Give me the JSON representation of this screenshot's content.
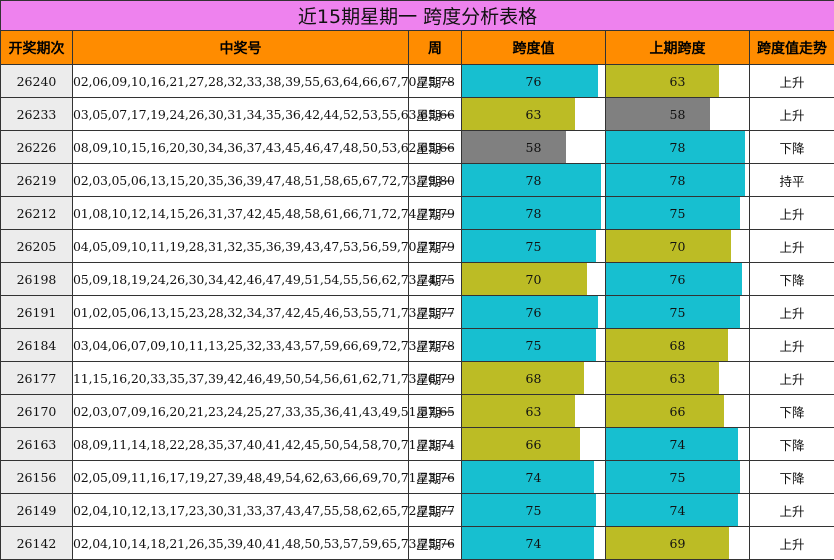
{
  "title": "近15期星期一 跨度分析表格",
  "headers": [
    "开奖期次",
    "中奖号",
    "周",
    "跨度值",
    "上期跨度",
    "跨度值走势"
  ],
  "colors": {
    "cyan": "#17bfd0",
    "olive": "#bcbc25",
    "gray": "#808080"
  },
  "bar_max": 80,
  "rows": [
    {
      "issue": "26240",
      "numbers": "02,06,09,10,16,21,27,28,32,33,38,39,55,63,64,66,67,70,75,78",
      "week": "星期一",
      "span": 76,
      "span_color": "cyan",
      "prev": 63,
      "prev_color": "olive",
      "trend": "上升"
    },
    {
      "issue": "26233",
      "numbers": "03,05,07,17,19,24,26,30,31,34,35,36,42,44,52,53,55,63,65,66",
      "week": "星期一",
      "span": 63,
      "span_color": "olive",
      "prev": 58,
      "prev_color": "gray",
      "trend": "上升"
    },
    {
      "issue": "26226",
      "numbers": "08,09,10,15,16,20,30,34,36,37,43,45,46,47,48,50,53,62,65,66",
      "week": "星期一",
      "span": 58,
      "span_color": "gray",
      "prev": 78,
      "prev_color": "cyan",
      "trend": "下降"
    },
    {
      "issue": "26219",
      "numbers": "02,03,05,06,13,15,20,35,36,39,47,48,51,58,65,67,72,73,79,80",
      "week": "星期一",
      "span": 78,
      "span_color": "cyan",
      "prev": 78,
      "prev_color": "cyan",
      "trend": "持平"
    },
    {
      "issue": "26212",
      "numbers": "01,08,10,12,14,15,26,31,37,42,45,48,58,61,66,71,72,74,77,79",
      "week": "星期一",
      "span": 78,
      "span_color": "cyan",
      "prev": 75,
      "prev_color": "cyan",
      "trend": "上升"
    },
    {
      "issue": "26205",
      "numbers": "04,05,09,10,11,19,28,31,32,35,36,39,43,47,53,56,59,70,77,79",
      "week": "星期一",
      "span": 75,
      "span_color": "cyan",
      "prev": 70,
      "prev_color": "olive",
      "trend": "上升"
    },
    {
      "issue": "26198",
      "numbers": "05,09,18,19,24,26,30,34,42,46,47,49,51,54,55,56,62,73,74,75",
      "week": "星期一",
      "span": 70,
      "span_color": "olive",
      "prev": 76,
      "prev_color": "cyan",
      "trend": "下降"
    },
    {
      "issue": "26191",
      "numbers": "01,02,05,06,13,15,23,28,32,34,37,42,45,46,53,55,71,73,75,77",
      "week": "星期一",
      "span": 76,
      "span_color": "cyan",
      "prev": 75,
      "prev_color": "cyan",
      "trend": "上升"
    },
    {
      "issue": "26184",
      "numbers": "03,04,06,07,09,10,11,13,25,32,33,43,57,59,66,69,72,73,77,78",
      "week": "星期一",
      "span": 75,
      "span_color": "cyan",
      "prev": 68,
      "prev_color": "olive",
      "trend": "上升"
    },
    {
      "issue": "26177",
      "numbers": "11,15,16,20,33,35,37,39,42,46,49,50,54,56,61,62,71,73,76,79",
      "week": "星期一",
      "span": 68,
      "span_color": "olive",
      "prev": 63,
      "prev_color": "olive",
      "trend": "上升"
    },
    {
      "issue": "26170",
      "numbers": "02,03,07,09,16,20,21,23,24,25,27,33,35,36,41,43,49,51,57,65",
      "week": "星期一",
      "span": 63,
      "span_color": "olive",
      "prev": 66,
      "prev_color": "olive",
      "trend": "下降"
    },
    {
      "issue": "26163",
      "numbers": "08,09,11,14,18,22,28,35,37,40,41,42,45,50,54,58,70,71,73,74",
      "week": "星期一",
      "span": 66,
      "span_color": "olive",
      "prev": 74,
      "prev_color": "cyan",
      "trend": "下降"
    },
    {
      "issue": "26156",
      "numbers": "02,05,09,11,16,17,19,27,39,48,49,54,62,63,66,69,70,71,73,76",
      "week": "星期一",
      "span": 74,
      "span_color": "cyan",
      "prev": 75,
      "prev_color": "cyan",
      "trend": "下降"
    },
    {
      "issue": "26149",
      "numbers": "02,04,10,12,13,17,23,30,31,33,37,43,47,55,58,62,65,72,75,77",
      "week": "星期一",
      "span": 75,
      "span_color": "cyan",
      "prev": 74,
      "prev_color": "cyan",
      "trend": "上升"
    },
    {
      "issue": "26142",
      "numbers": "02,04,10,14,18,21,26,35,39,40,41,48,50,53,57,59,65,73,75,76",
      "week": "星期一",
      "span": 74,
      "span_color": "cyan",
      "prev": 69,
      "prev_color": "olive",
      "trend": "上升"
    }
  ]
}
